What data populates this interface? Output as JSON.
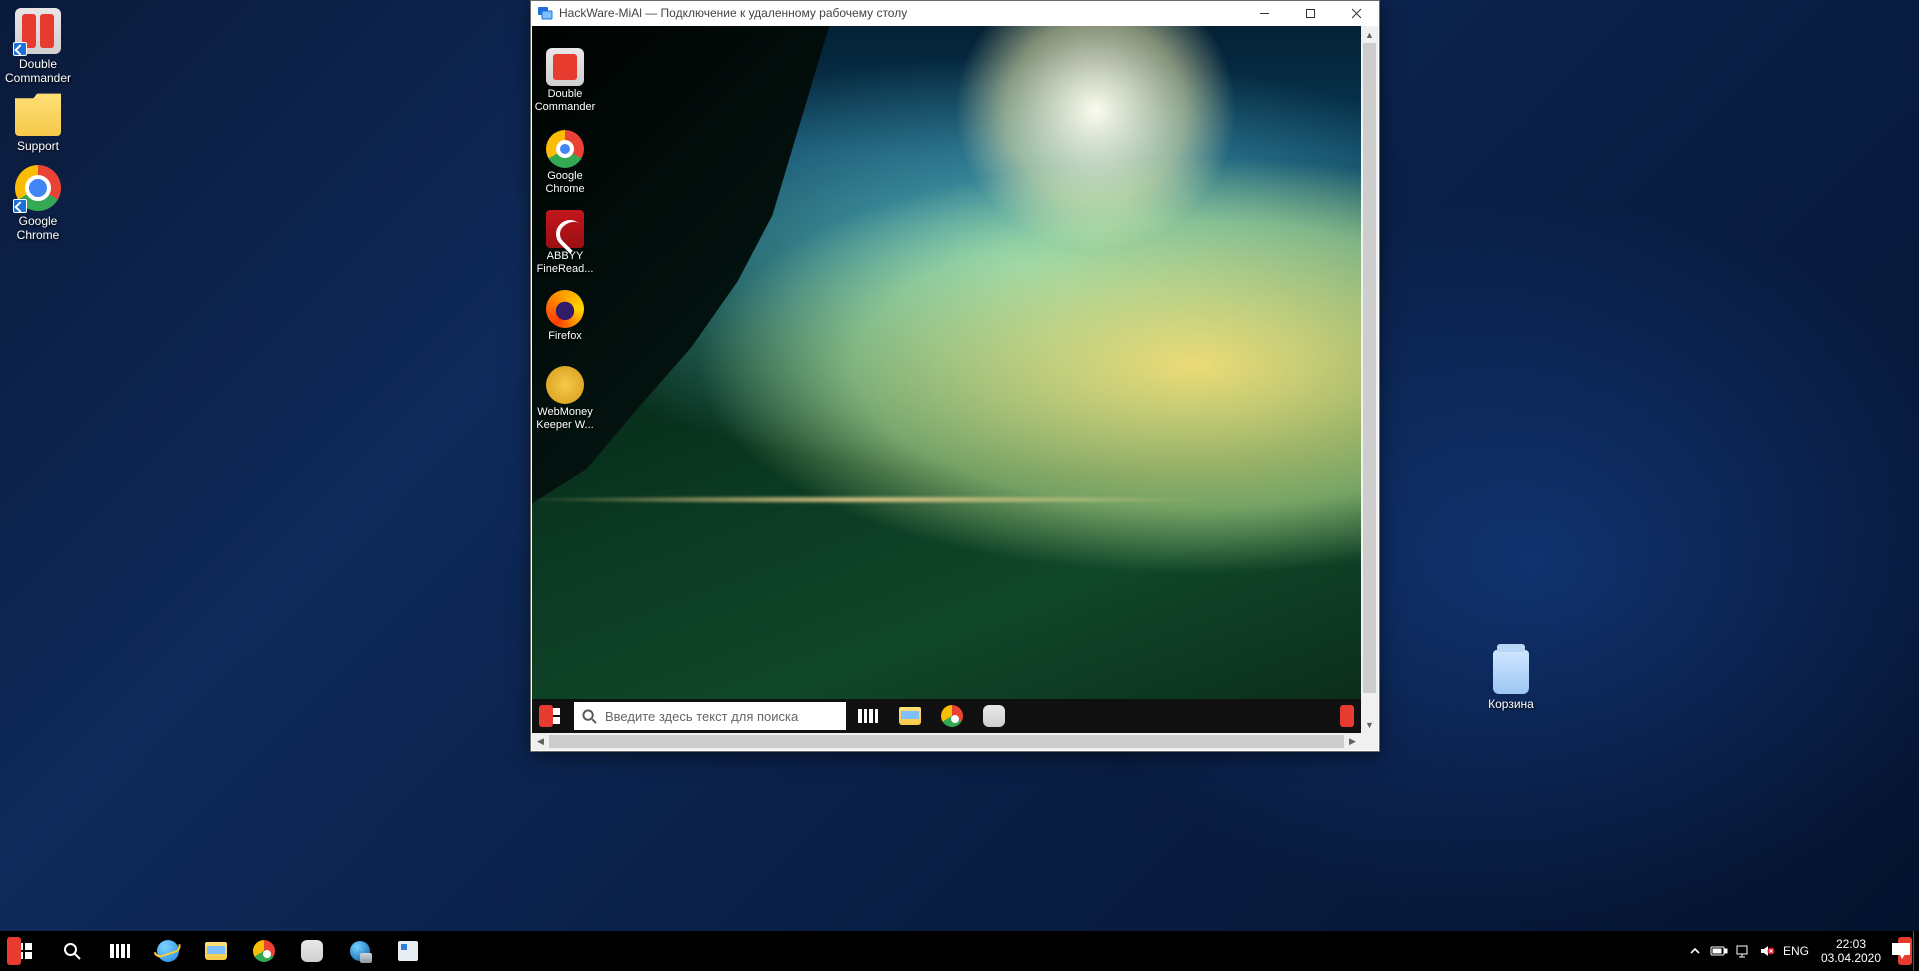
{
  "local_desktop_icons": [
    {
      "label": "Double Commander"
    },
    {
      "label": "Support"
    },
    {
      "label": "Google Chrome"
    }
  ],
  "recycle_bin": {
    "label": "Корзина"
  },
  "rdp": {
    "title": "HackWare-MiAl — Подключение к удаленному рабочему столу",
    "remote_desktop_icons": [
      {
        "label": "Double Commander"
      },
      {
        "label": "Google Chrome"
      },
      {
        "label": "ABBYY FineRead..."
      },
      {
        "label": "Firefox"
      },
      {
        "label": "WebMoney Keeper W..."
      }
    ],
    "remote_search_placeholder": "Введите здесь текст для поиска"
  },
  "taskbar": {
    "lang": "ENG",
    "time": "22:03",
    "date": "03.04.2020"
  }
}
